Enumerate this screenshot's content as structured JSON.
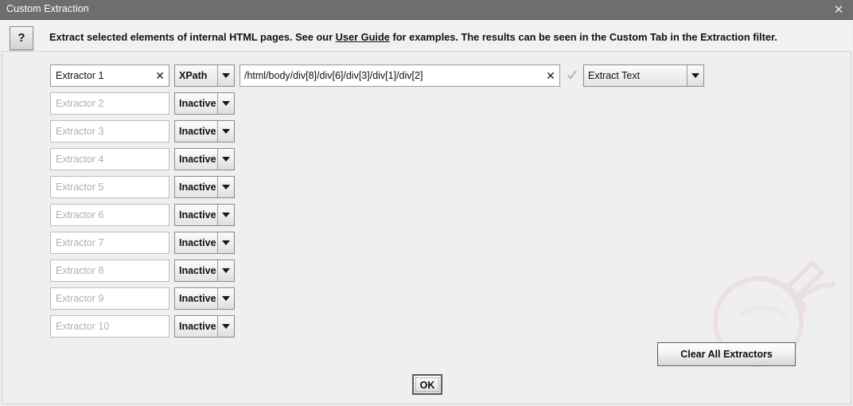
{
  "window": {
    "title": "Custom Extraction",
    "close_icon": "close-icon"
  },
  "notice": {
    "help_icon": "?",
    "text_before_link": "Extract selected elements of internal HTML pages. See our ",
    "link_label": "User Guide",
    "text_after_link": " for examples. The results can be seen in the Custom Tab in the Extraction filter."
  },
  "rows": [
    {
      "name_value": "Extractor 1",
      "name_placeholder": "",
      "active": true,
      "clear_icon": "✕",
      "type": "XPath",
      "xpath_value": "/html/body/div[8]/div[6]/div[3]/div[1]/div[2]",
      "xpath_clear_icon": "✕",
      "valid_icon": "check-icon",
      "extract_as": "Extract Text"
    },
    {
      "name_value": "",
      "name_placeholder": "Extractor 2",
      "active": false,
      "type": "Inactive"
    },
    {
      "name_value": "",
      "name_placeholder": "Extractor 3",
      "active": false,
      "type": "Inactive"
    },
    {
      "name_value": "",
      "name_placeholder": "Extractor 4",
      "active": false,
      "type": "Inactive"
    },
    {
      "name_value": "",
      "name_placeholder": "Extractor 5",
      "active": false,
      "type": "Inactive"
    },
    {
      "name_value": "",
      "name_placeholder": "Extractor 6",
      "active": false,
      "type": "Inactive"
    },
    {
      "name_value": "",
      "name_placeholder": "Extractor 7",
      "active": false,
      "type": "Inactive"
    },
    {
      "name_value": "",
      "name_placeholder": "Extractor 8",
      "active": false,
      "type": "Inactive"
    },
    {
      "name_value": "",
      "name_placeholder": "Extractor 9",
      "active": false,
      "type": "Inactive"
    },
    {
      "name_value": "",
      "name_placeholder": "Extractor 10",
      "active": false,
      "type": "Inactive"
    }
  ],
  "buttons": {
    "clear_all": "Clear All Extractors",
    "ok": "OK"
  },
  "colors": {
    "titlebar_bg": "#6e6e6e",
    "dialog_bg": "#efefef",
    "notice_bg": "#f1f1f1",
    "placeholder_text": "#b0b0b0",
    "tick": "#b4b4b4",
    "watermark": "#e8cdcd"
  }
}
